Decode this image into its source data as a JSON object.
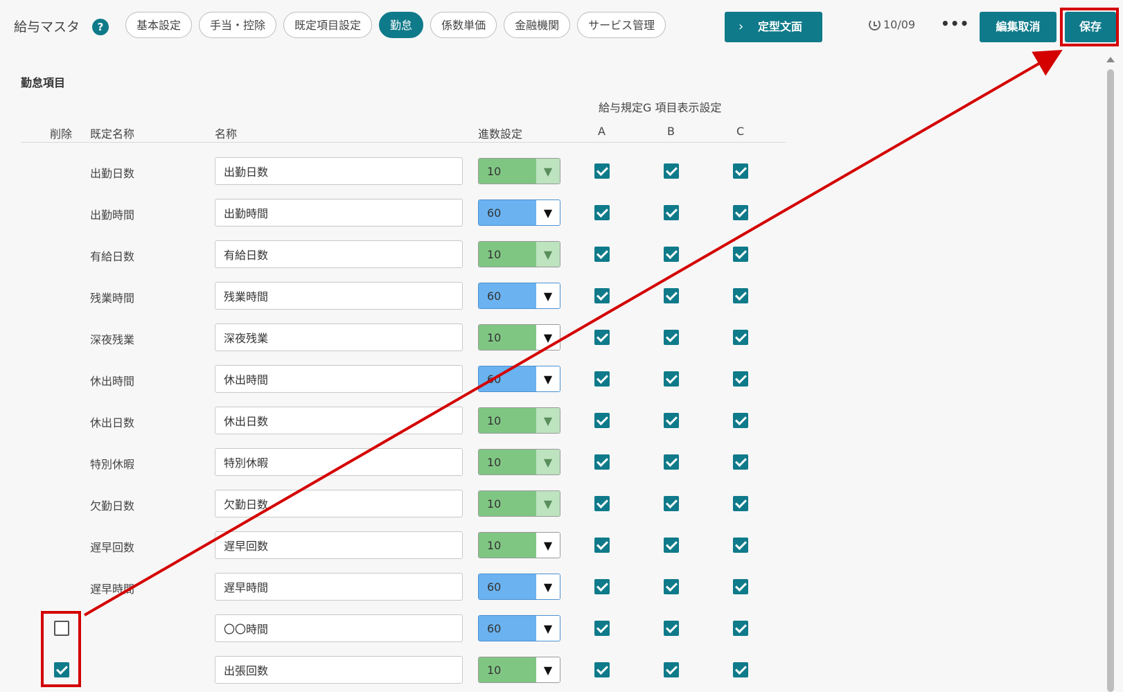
{
  "header": {
    "title": "給与マスタ",
    "help_icon": "?",
    "tabs": [
      {
        "label": "基本設定"
      },
      {
        "label": "手当・控除"
      },
      {
        "label": "既定項目設定"
      },
      {
        "label": "勤怠",
        "active": true
      },
      {
        "label": "係数単価"
      },
      {
        "label": "金融機関"
      },
      {
        "label": "サービス管理"
      }
    ],
    "teiki_label": "定型文面",
    "teiki_icon": "›",
    "history_date": "10/09",
    "more_icon": "•••",
    "cancel_label": "編集取消",
    "save_label": "保存"
  },
  "section": {
    "title": "勤怠項目",
    "group_header": "給与規定G 項目表示設定",
    "columns": {
      "delete": "削除",
      "default_name": "既定名称",
      "name": "名称",
      "rounding": "進数設定",
      "a": "A",
      "b": "B",
      "c": "C"
    }
  },
  "rows": [
    {
      "default_name": "出勤日数",
      "name": "出勤日数",
      "rounding": "10",
      "color": "green",
      "locked": true,
      "a": true,
      "b": true,
      "c": true
    },
    {
      "default_name": "出勤時間",
      "name": "出勤時間",
      "rounding": "60",
      "color": "blue",
      "locked": false,
      "a": true,
      "b": true,
      "c": true
    },
    {
      "default_name": "有給日数",
      "name": "有給日数",
      "rounding": "10",
      "color": "green",
      "locked": true,
      "a": true,
      "b": true,
      "c": true
    },
    {
      "default_name": "残業時間",
      "name": "残業時間",
      "rounding": "60",
      "color": "blue",
      "locked": false,
      "a": true,
      "b": true,
      "c": true
    },
    {
      "default_name": "深夜残業",
      "name": "深夜残業",
      "rounding": "10",
      "color": "green",
      "locked": false,
      "a": true,
      "b": true,
      "c": true
    },
    {
      "default_name": "休出時間",
      "name": "休出時間",
      "rounding": "60",
      "color": "blue",
      "locked": false,
      "a": true,
      "b": true,
      "c": true
    },
    {
      "default_name": "休出日数",
      "name": "休出日数",
      "rounding": "10",
      "color": "green",
      "locked": true,
      "a": true,
      "b": true,
      "c": true
    },
    {
      "default_name": "特別休暇",
      "name": "特別休暇",
      "rounding": "10",
      "color": "green",
      "locked": true,
      "a": true,
      "b": true,
      "c": true
    },
    {
      "default_name": "欠勤日数",
      "name": "欠勤日数",
      "rounding": "10",
      "color": "green",
      "locked": true,
      "a": true,
      "b": true,
      "c": true
    },
    {
      "default_name": "遅早回数",
      "name": "遅早回数",
      "rounding": "10",
      "color": "green",
      "locked": false,
      "a": true,
      "b": true,
      "c": true
    },
    {
      "default_name": "遅早時間",
      "name": "遅早時間",
      "rounding": "60",
      "color": "blue",
      "locked": false,
      "a": true,
      "b": true,
      "c": true
    },
    {
      "default_name": "",
      "name": "〇〇時間",
      "rounding": "60",
      "color": "blue",
      "locked": false,
      "delete": false,
      "a": true,
      "b": true,
      "c": true
    },
    {
      "default_name": "",
      "name": "出張回数",
      "rounding": "10",
      "color": "green",
      "locked": false,
      "delete": true,
      "a": true,
      "b": true,
      "c": true
    }
  ],
  "select_arrow": "▼",
  "colors": {
    "accent": "#0f7a8a",
    "annotation": "#d40000",
    "select_green": "#80c683",
    "select_blue": "#6ab2f0"
  }
}
